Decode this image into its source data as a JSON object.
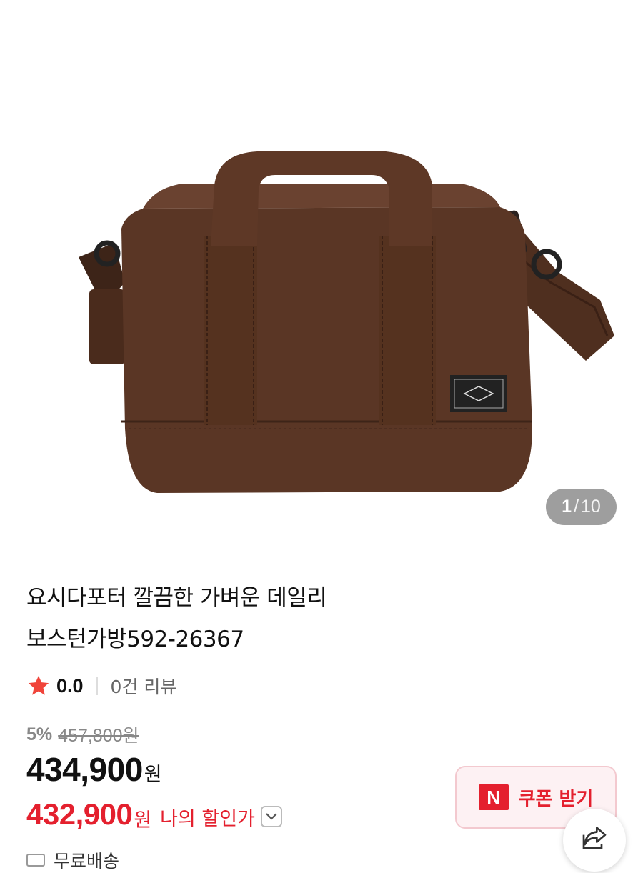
{
  "gallery": {
    "product_image": "brown-canvas-boston-bag-photo",
    "counter_current": "1",
    "counter_separator": "/",
    "counter_total": "10"
  },
  "product": {
    "title_line1": "요시다포터 깔끔한 가벼운 데일리",
    "title_line2": "보스턴가방592-26367"
  },
  "rating": {
    "icon": "star-icon",
    "score": "0.0",
    "review_count": "0건 리뷰",
    "star_color": "#f0443a"
  },
  "pricing": {
    "discount_rate": "5%",
    "original_price": "457,800원",
    "price": "434,900",
    "currency": "원",
    "my_price": "432,900",
    "my_currency": "원",
    "my_price_label": "나의 할인가",
    "accent_color": "#e4202e"
  },
  "coupon": {
    "logo_text": "N",
    "label": "쿠폰 받기"
  },
  "share": {
    "icon": "share-icon"
  },
  "delivery": {
    "icon": "truck-icon",
    "label": "무료배송"
  }
}
